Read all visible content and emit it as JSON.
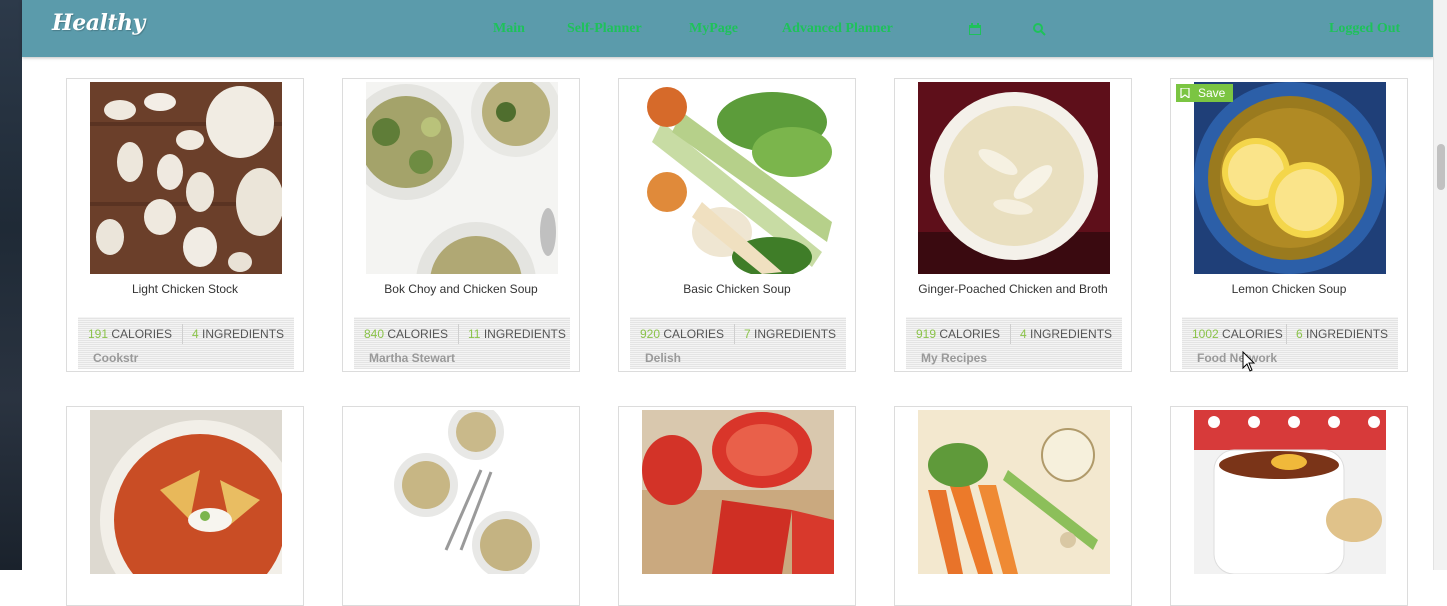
{
  "navbar": {
    "logo": "Healthy",
    "items": [
      "Main",
      "Self-Planner",
      "MyPage",
      "Advanced Planner"
    ],
    "calendar_icon": "calendar-icon",
    "search_icon": "search-icon",
    "logout": "Logged Out"
  },
  "save_label": "Save",
  "units": {
    "calories": "CALORIES",
    "ingredients": "INGREDIENTS"
  },
  "recipes": [
    {
      "title": "Light Chicken Stock",
      "calories": "191",
      "ingredients": "4",
      "source": "Cookstr"
    },
    {
      "title": "Bok Choy and Chicken Soup",
      "calories": "840",
      "ingredients": "11",
      "source": "Martha Stewart"
    },
    {
      "title": "Basic Chicken Soup",
      "calories": "920",
      "ingredients": "7",
      "source": "Delish"
    },
    {
      "title": "Ginger-Poached Chicken and Broth",
      "calories": "919",
      "ingredients": "4",
      "source": "My Recipes"
    },
    {
      "title": "Lemon Chicken Soup",
      "calories": "1002",
      "ingredients": "6",
      "source": "Food Network"
    }
  ],
  "colors": {
    "navbar": "#5b9bab",
    "nav_link": "#1ec25a",
    "stat_number": "#8bc34a",
    "save": "#7bc542"
  }
}
